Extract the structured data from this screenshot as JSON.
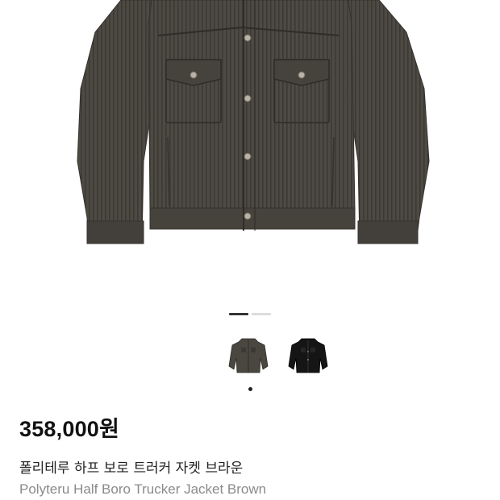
{
  "product": {
    "price": "358,000원",
    "name_ko": "폴리테루 하프 보로 트러커 자켓 브라운",
    "name_en": "Polyteru Half Boro Trucker Jacket Brown"
  },
  "gallery": {
    "main_image": "brown-corduroy-trucker-jacket",
    "pager": {
      "current": 1,
      "total": 2
    }
  },
  "color_options": [
    {
      "name": "brown-jacket-thumbnail",
      "color": "#4a4640",
      "selected": true
    },
    {
      "name": "black-jacket-thumbnail",
      "color": "#151515",
      "selected": false
    }
  ],
  "colors": {
    "jacket_brown": "#4d4943",
    "jacket_black": "#151515",
    "price_text": "#111111",
    "secondary_text": "#8a8a8a",
    "pager_active": "#333333",
    "pager_inactive": "#dcdcdc"
  }
}
